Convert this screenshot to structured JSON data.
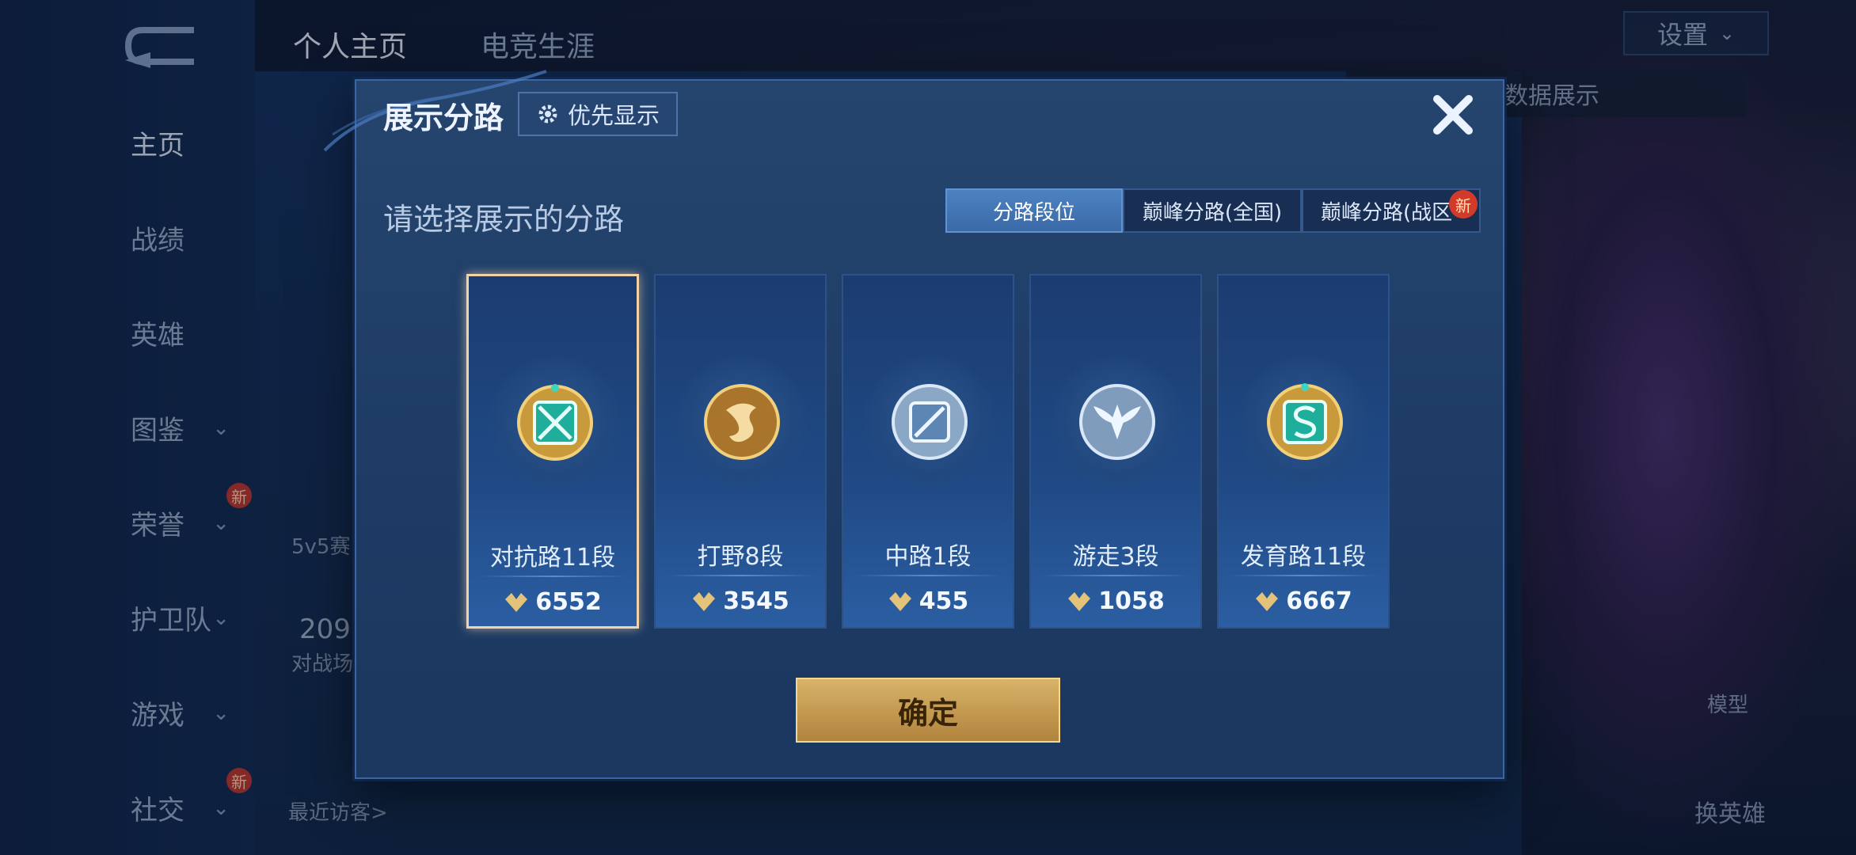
{
  "background": {
    "nav": {
      "items": [
        {
          "label": "主页",
          "active": true,
          "chevron": false,
          "new": false
        },
        {
          "label": "战绩",
          "active": false,
          "chevron": false,
          "new": false
        },
        {
          "label": "英雄",
          "active": false,
          "chevron": false,
          "new": false
        },
        {
          "label": "图鉴",
          "active": false,
          "chevron": true,
          "new": false
        },
        {
          "label": "荣誉",
          "active": false,
          "chevron": true,
          "new": true
        },
        {
          "label": "护卫队",
          "active": false,
          "chevron": true,
          "new": false
        },
        {
          "label": "游戏",
          "active": false,
          "chevron": true,
          "new": false
        },
        {
          "label": "社交",
          "active": false,
          "chevron": true,
          "new": true
        }
      ],
      "new_badge": "新"
    },
    "tabs": [
      "个人主页",
      "电竞生涯"
    ],
    "settings_label": "设置",
    "hint_text": "点切换灵宝和数据展示",
    "rank_text": "5v5赛",
    "count_text": "209",
    "battle_text": "对战场",
    "recent_visitors": "最近访客>",
    "model_label": "模型",
    "switch_hero_label": "换英雄"
  },
  "dialog": {
    "title": "展示分路",
    "priority_label": "优先显示",
    "subtitle": "请选择展示的分路",
    "segments": [
      "分路段位",
      "巅峰分路(全国)",
      "巅峰分路(战区"
    ],
    "segment_new": "新",
    "cards": [
      {
        "name": "对抗路11段",
        "score": "6552",
        "selected": true,
        "emblem": "clash-lane-emblem-icon"
      },
      {
        "name": "打野8段",
        "score": "3545",
        "selected": false,
        "emblem": "jungle-dragon-emblem-icon"
      },
      {
        "name": "中路1段",
        "score": "455",
        "selected": false,
        "emblem": "mid-lane-emblem-icon"
      },
      {
        "name": "游走3段",
        "score": "1058",
        "selected": false,
        "emblem": "roam-wings-emblem-icon"
      },
      {
        "name": "发育路11段",
        "score": "6667",
        "selected": false,
        "emblem": "farm-lane-emblem-icon"
      }
    ],
    "confirm_label": "确定"
  },
  "colors": {
    "accent_gold": "#c59b52",
    "dialog_bg": "#1e3c66",
    "selected_border": "#f4d2a8"
  }
}
